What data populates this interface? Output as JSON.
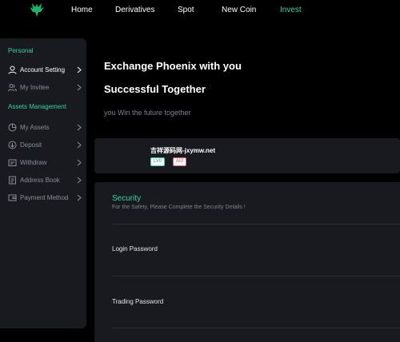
{
  "nav": {
    "logo": "phoenix-logo",
    "items": [
      {
        "label": "Home",
        "active": false
      },
      {
        "label": "Derivatives",
        "active": false
      },
      {
        "label": "Spot",
        "active": false
      },
      {
        "label": "New Coin",
        "active": false
      },
      {
        "label": "Invest",
        "active": true
      }
    ]
  },
  "sidebar": {
    "personal_label": "Personal",
    "assets_label": "Assets Management",
    "items": [
      {
        "label": "Account Setting",
        "icon": "user-icon",
        "active": true
      },
      {
        "label": "My Invitee",
        "icon": "users-icon",
        "active": false
      },
      {
        "label": "My Assets",
        "icon": "pie-chart-icon",
        "active": false
      },
      {
        "label": "Deposit",
        "icon": "deposit-icon",
        "active": false
      },
      {
        "label": "Withdraw",
        "icon": "withdraw-icon",
        "active": false
      },
      {
        "label": "Address Book",
        "icon": "address-book-icon",
        "active": false
      },
      {
        "label": "Payment Method",
        "icon": "payment-icon",
        "active": false
      }
    ]
  },
  "hero": {
    "line1": "Exchange Phoenix with you",
    "line2": "Successful Together",
    "subtitle": "you Win the future together"
  },
  "profile": {
    "name": "吉祥源码网-jxymw.net",
    "level_badge": "LV0",
    "ai_badge": "AI0"
  },
  "security": {
    "title": "Security",
    "description": "For the Safety, Please Complete the Security Details !",
    "rows": [
      {
        "label": "Login Password"
      },
      {
        "label": "Trading Password"
      }
    ]
  },
  "colors": {
    "accent": "#3ad29f",
    "panel": "#181a1f",
    "background": "#000000",
    "muted_text": "#8a8f99"
  }
}
